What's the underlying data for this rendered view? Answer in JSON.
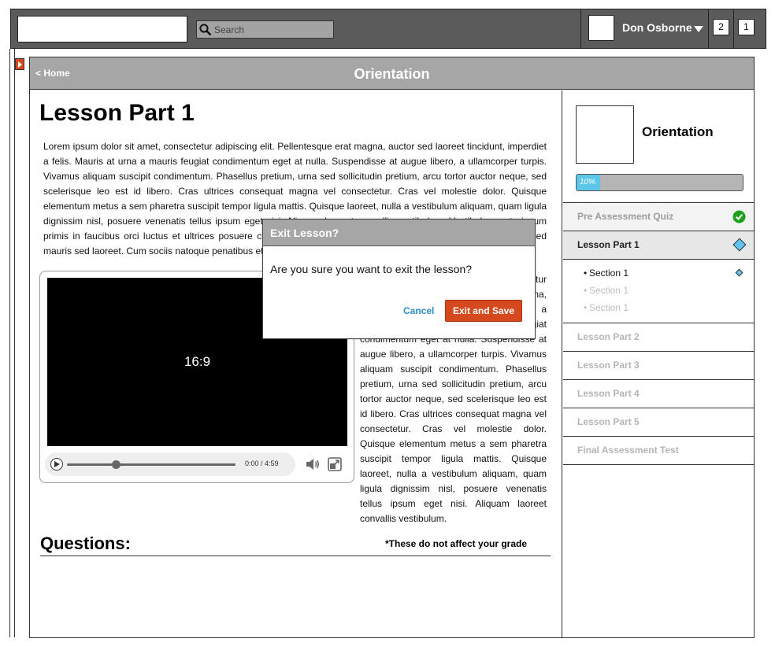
{
  "topbar": {
    "search_placeholder": "Search",
    "user_name": "Don Osborne",
    "badge_1": "2",
    "badge_2": "1"
  },
  "header": {
    "home_link": "< Home",
    "title": "Orientation"
  },
  "content": {
    "lesson_title": "Lesson Part 1",
    "paragraph_1": "Lorem ipsum dolor sit amet, consectetur adipiscing elit. Pellentesque erat magna, auctor sed laoreet tincidunt, imperdiet a felis. Mauris at urna a mauris feugiat condimentum eget at nulla. Suspendisse at augue libero, a ullamcorper turpis. Vivamus aliquam suscipit condimentum. Phasellus pretium, urna sed sollicitudin pretium, arcu tortor auctor neque, sed scelerisque leo est id libero. Cras ultrices consequat magna vel consectetur. Cras vel molestie dolor. Quisque elementum metus a sem pharetra suscipit tempor ligula mattis. Quisque laoreet, nulla a vestibulum aliquam, quam ligula dignissim nisl, posuere venenatis tellus ipsum eget nisi. Aliquam laoreet convallis vestibulum. Vestibulum ante ipsum primis in faucibus orci luctus et ultrices posuere cubilia Curae; Maecenas vitae lacus sapien. Vivamus tristique sed mauris sed laoreet. Cum sociis natoque penatibus et magnis dis parturient montes, nascetur ridiculus mus.",
    "paragraph_2": "Lorem ipsum dolor sit amet, consectetur adipiscing elit. Pellentesque erat magna, auctor sed laoreet tincidunt, imperdiet a felis. Mauris at urna a mauris feugiat condimentum eget at nulla. Suspendisse at augue libero, a ullamcorper turpis. Vivamus aliquam suscipit condimentum. Phasellus pretium, urna sed sollicitudin pretium, arcu tortor auctor neque, sed scelerisque leo est id libero. Cras ultrices consequat magna vel consectetur. Cras vel molestie dolor. Quisque elementum metus a sem pharetra suscipit tempor ligula mattis. Quisque laoreet, nulla a vestibulum aliquam, quam ligula dignissim nisl, posuere venenatis tellus ipsum eget nisi. Aliquam laoreet convallis vestibulum.",
    "video_ratio": "16:9",
    "video_time": "0:00  /  4:59",
    "video_progress": 0.29,
    "questions_heading": "Questions:",
    "grade_note": "*These do not affect your grade"
  },
  "course": {
    "name": "Orientation",
    "progress_label": "10%",
    "progress_value": 0.14,
    "items": [
      {
        "label": "Pre Assessment Quiz",
        "state": "done"
      },
      {
        "label": "Lesson Part 1",
        "state": "active"
      },
      {
        "label": "Lesson Part 2",
        "state": "locked"
      },
      {
        "label": "Lesson Part 3",
        "state": "locked"
      },
      {
        "label": "Lesson Part 4",
        "state": "locked"
      },
      {
        "label": "Lesson Part 5",
        "state": "locked"
      },
      {
        "label": "Final Assessment Test",
        "state": "locked"
      }
    ],
    "sections": [
      "Section 1",
      "Section 1",
      "Section 1"
    ]
  },
  "modal": {
    "title": "Exit Lesson?",
    "message": "Are you sure you want to exit the lesson?",
    "cancel_label": "Cancel",
    "confirm_label": "Exit and Save"
  },
  "colors": {
    "accent": "#d6491e",
    "progress": "#5bc6e8",
    "complete": "#1aa31a",
    "link": "#2f8bc9"
  }
}
